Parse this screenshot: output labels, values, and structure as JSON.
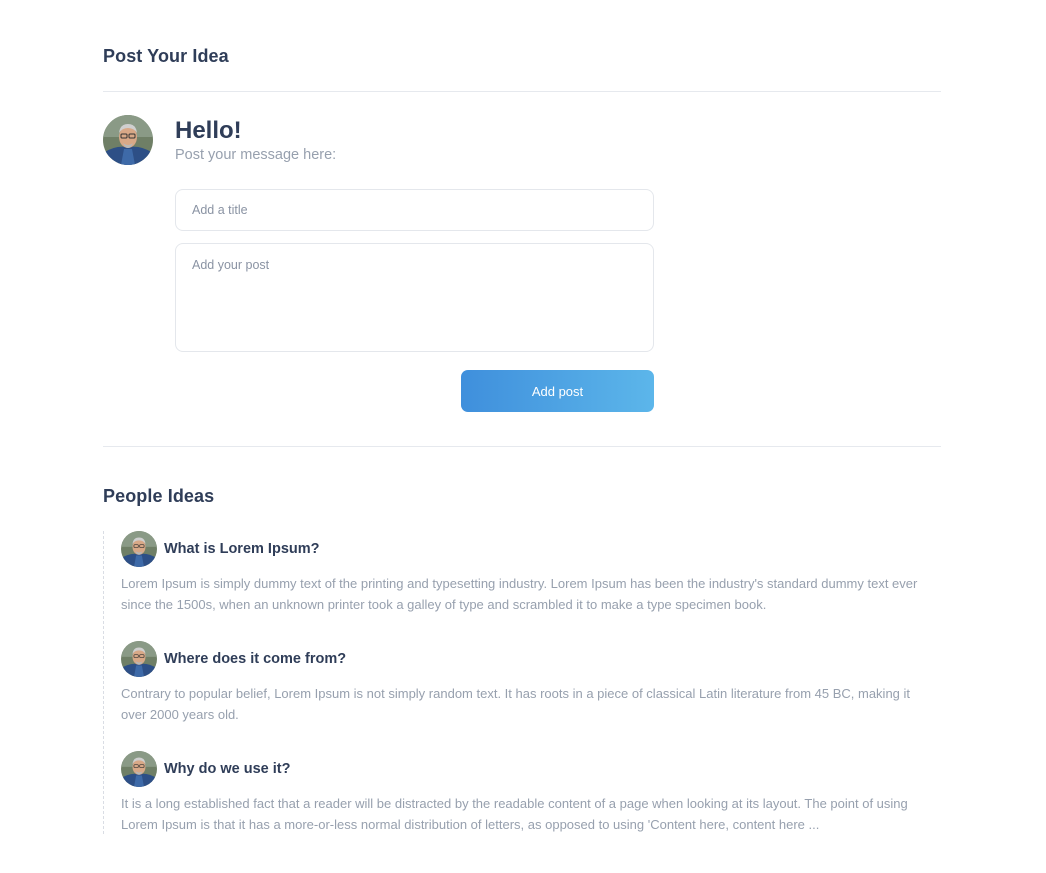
{
  "post_section": {
    "title": "Post Your Idea",
    "greeting": "Hello!",
    "subtitle": "Post your message here:",
    "title_placeholder": "Add a title",
    "post_placeholder": "Add your post",
    "submit_label": "Add post"
  },
  "ideas_section": {
    "title": "People Ideas",
    "items": [
      {
        "title": "What is Lorem Ipsum?",
        "body": "Lorem Ipsum is simply dummy text of the printing and typesetting industry. Lorem Ipsum has been the industry's standard dummy text ever since the 1500s, when an unknown printer took a galley of type and scrambled it to make a type specimen book."
      },
      {
        "title": "Where does it come from?",
        "body": "Contrary to popular belief, Lorem Ipsum is not simply random text. It has roots in a piece of classical Latin literature from 45 BC, making it over 2000 years old."
      },
      {
        "title": "Why do we use it?",
        "body": "It is a long established fact that a reader will be distracted by the readable content of a page when looking at its layout. The point of using Lorem Ipsum is that it has a more-or-less normal distribution of letters, as opposed to using 'Content here, content here ..."
      }
    ]
  },
  "colors": {
    "accent_start": "#3f8fdc",
    "accent_end": "#5cb6ea",
    "heading": "#2f3d58",
    "muted": "#97a0ae"
  },
  "icons": {
    "avatar": "user-avatar-photo"
  }
}
